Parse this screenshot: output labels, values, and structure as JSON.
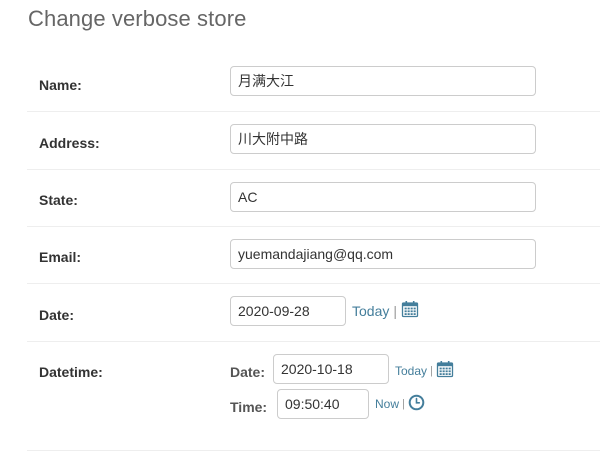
{
  "page": {
    "title": "Change verbose store"
  },
  "fields": {
    "name": {
      "label": "Name:",
      "value": "月满大江"
    },
    "address": {
      "label": "Address:",
      "value": "川大附中路"
    },
    "state": {
      "label": "State:",
      "value": "AC"
    },
    "email": {
      "label": "Email:",
      "value": "yuemandajiang@qq.com"
    },
    "date": {
      "label": "Date:",
      "value": "2020-09-28",
      "today_link": "Today",
      "separator": "|",
      "icon": "calendar-icon"
    },
    "datetime": {
      "label": "Datetime:",
      "date_label": "Date:",
      "date_value": "2020-10-18",
      "today_link": "Today",
      "time_label": "Time:",
      "time_value": "09:50:40",
      "now_link": "Now",
      "separator": "|",
      "date_icon": "calendar-icon",
      "time_icon": "clock-icon"
    }
  },
  "colors": {
    "link": "#447e9b",
    "icon": "#447e9b",
    "label": "#333333",
    "title": "#666666"
  }
}
